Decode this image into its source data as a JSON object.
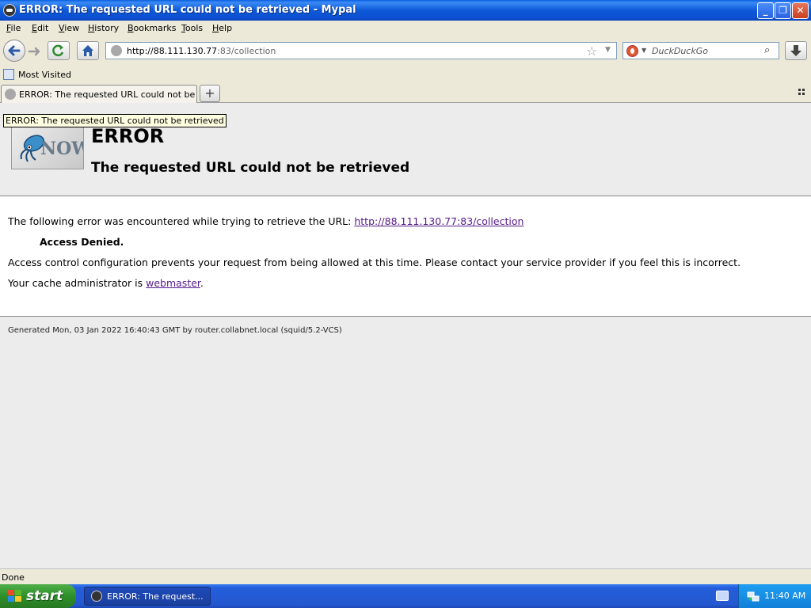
{
  "window": {
    "title": "ERROR: The requested URL could not be retrieved - Mypal",
    "minimize": "_",
    "restore": "❐",
    "close": "✕"
  },
  "menu": [
    "File",
    "Edit",
    "View",
    "History",
    "Bookmarks",
    "Tools",
    "Help"
  ],
  "nav": {
    "url_host": "http://88.111.130.77",
    "url_rest": ":83/collection",
    "search_placeholder": "DuckDuckGo"
  },
  "bookmarks": {
    "most_visited": "Most Visited"
  },
  "tabs": [
    {
      "label": "ERROR: The requested URL could not be ret..."
    }
  ],
  "tooltip": "ERROR: The requested URL could not be retrieved",
  "page": {
    "logo_text": "NOW",
    "heading": "ERROR",
    "subheading": "The requested URL could not be retrieved",
    "intro": "The following error was encountered while trying to retrieve the URL: ",
    "intro_link": "http://88.111.130.77:83/collection",
    "denied": "Access Denied.",
    "explanation": "Access control configuration prevents your request from being allowed at this time. Please contact your service provider if you feel this is incorrect.",
    "admin_prefix": "Your cache administrator is ",
    "admin_link": "webmaster",
    "admin_suffix": ".",
    "generated": "Generated Mon, 03 Jan 2022 16:40:43 GMT by router.collabnet.local (squid/5.2-VCS)"
  },
  "status": "Done",
  "taskbar": {
    "start": "start",
    "task_label": "ERROR: The request...",
    "clock": "11:40 AM"
  }
}
